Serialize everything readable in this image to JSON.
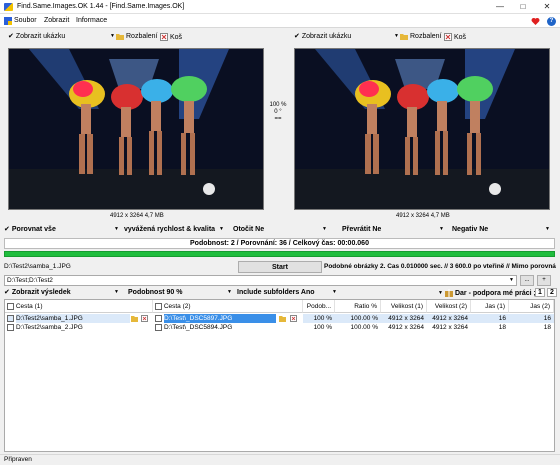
{
  "window": {
    "title": "Find.Same.Images.OK 1.44 - [Find.Same.Images.OK]"
  },
  "menu": {
    "items": [
      "Soubor",
      "Zobrazit",
      "Informace"
    ]
  },
  "left_panel": {
    "show_preview": "Zobrazit ukázku",
    "unzip": "Rozbalení",
    "trash": "Koš",
    "caption": "4912 x 3264 4,7 MB"
  },
  "right_panel": {
    "show_preview": "Zobrazit ukázku",
    "unzip": "Rozbalení",
    "trash": "Koš",
    "caption": "4912 x 3264 4,7 MB"
  },
  "center_info": {
    "percent": "100 %",
    "angle": "0 °",
    "equals": "=="
  },
  "options": {
    "compare": "Porovnat vše",
    "speed": "vyvážená rychlost & kvalita",
    "rotate": "Otočit Ne",
    "flip": "Převrátit Ne",
    "negative": "Negativ Ne"
  },
  "similarity_bar": "Podobnost: 2 / Porovnání: 36 / Celkový čas: 00:00.060",
  "progress": 1.0,
  "current_path": "D:\\Test2\\samba_1.JPG",
  "start_button": "Start",
  "status_line": "Podobné obrázky 2. Čas 0.010000 sec. // 3 600.0 po vteřině // Mimo porovnání",
  "folder_input": "D:\\Test;D:\\Test2",
  "buttons": {
    "browse": "...",
    "plus": "+"
  },
  "results_toolbar": {
    "show_results": "Zobrazit výsledek",
    "similarity": "Podobnost 90 %",
    "subfolders": "Include subfolders Ano",
    "donate": "Dar - podpora mé práci ;)",
    "pager": "1",
    "pager_end": "2"
  },
  "grid": {
    "columns": [
      "Cesta (1)",
      "Cesta (2)",
      "Podob...",
      "Ratio %",
      "Velikost (1)",
      "Velikost (2)",
      "Jas (1)",
      "Jas (2)"
    ],
    "rows": [
      {
        "path1": "D:\\Test2\\samba_1.JPG",
        "path2": "D:\\Test\\_DSC5897.JPG",
        "similarity": "100 %",
        "ratio": "100.00 %",
        "size1": "4912 x 3264",
        "size2": "4912 x 3264",
        "jas1": "16",
        "jas2": "16"
      },
      {
        "path1": "D:\\Test2\\samba_2.JPG",
        "path2": "D:\\Test\\_DSC5894.JPG",
        "similarity": "100 %",
        "ratio": "100.00 %",
        "size1": "4912 x 3264",
        "size2": "4912 x 3264",
        "jas1": "18",
        "jas2": "18"
      }
    ]
  },
  "status_bar": "Připraven",
  "colors": {
    "progress": "#1fbd3d",
    "selection": "#3a8fe8"
  }
}
